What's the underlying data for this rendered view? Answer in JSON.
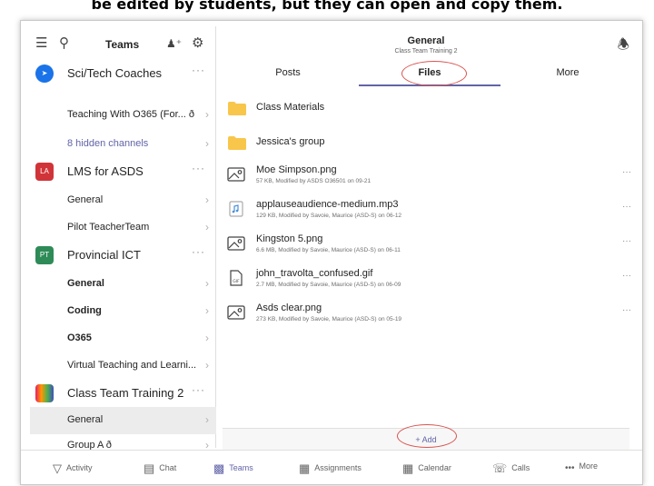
{
  "caption": "be edited by students, but they can open and copy them.",
  "sidebar": {
    "title": "Teams",
    "teams": [
      {
        "label": "Sci/Tech Coaches"
      },
      {
        "label": "LMS for ASDS",
        "badge": "LA",
        "badge_color": "#d13438"
      },
      {
        "label": "Provincial ICT",
        "badge": "PT",
        "badge_color": "#2e8b57"
      },
      {
        "label": "Class Team Training 2"
      }
    ],
    "channels": [
      {
        "label": "Teaching With O365  (For...  ð"
      },
      {
        "label": "8 hidden channels"
      },
      {
        "label": "General"
      },
      {
        "label": "Pilot TeacherTeam"
      },
      {
        "label": "General"
      },
      {
        "label": "Coding"
      },
      {
        "label": "O365"
      },
      {
        "label": "Virtual Teaching and Learni..."
      },
      {
        "label": "General"
      },
      {
        "label": "Group A ð"
      }
    ]
  },
  "main": {
    "title": "General",
    "subtitle": "Class Team Training 2",
    "tabs": [
      {
        "label": "Posts"
      },
      {
        "label": "Files"
      },
      {
        "label": "More"
      }
    ],
    "active_tab": "Files",
    "folders": [
      {
        "name": "Class Materials"
      },
      {
        "name": "Jessica's group"
      }
    ],
    "files": [
      {
        "name": "Moe Simpson.png",
        "meta": "57 KB, Modified by ASDS O36501 on 09-21",
        "icon": "image-file-icon"
      },
      {
        "name": "applauseaudience-medium.mp3",
        "meta": "129 KB, Modified by Savoie, Maurice (ASD-S) on 06-12",
        "icon": "audio-file-icon"
      },
      {
        "name": "Kingston 5.png",
        "meta": "6.6 MB, Modified by Savoie, Maurice (ASD-S) on 06-11",
        "icon": "image-file-icon"
      },
      {
        "name": "john_travolta_confused.gif",
        "meta": "2.7 MB, Modified by Savoie, Maurice (ASD-S) on 06-09",
        "icon": "gif-file-icon"
      },
      {
        "name": "Asds clear.png",
        "meta": "273 KB, Modified by Savoie, Maurice (ASD-S) on 05-19",
        "icon": "image-file-icon"
      }
    ],
    "add_label": "+   Add",
    "more_glyph": "···"
  },
  "bottom_nav": [
    {
      "label": "Activity",
      "icon": "bell-icon"
    },
    {
      "label": "Chat",
      "icon": "chat-icon"
    },
    {
      "label": "Teams",
      "icon": "teams-icon"
    },
    {
      "label": "Assignments",
      "icon": "assignments-icon"
    },
    {
      "label": "Calendar",
      "icon": "calendar-icon"
    },
    {
      "label": "Calls",
      "icon": "phone-icon"
    },
    {
      "label": "More",
      "icon": "more-icon"
    }
  ],
  "colors": {
    "accent": "#6264a7",
    "highlight": "#d9534f",
    "folder": "#f8c64a"
  }
}
